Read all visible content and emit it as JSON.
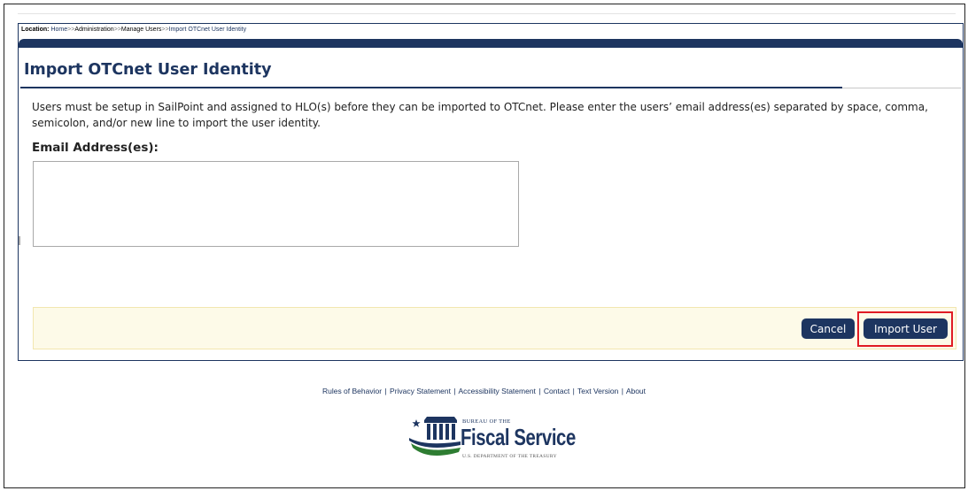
{
  "breadcrumb": {
    "label": "Location:",
    "items": [
      "Home",
      "Administration",
      "Manage Users",
      "Import OTCnet User Identity"
    ],
    "separator": ">>"
  },
  "page": {
    "title": "Import OTCnet User Identity",
    "instructions": "Users must be setup in SailPoint and assigned to HLO(s) before they can be imported to OTCnet. Please enter the users’ email address(es) separated by space, comma, semicolon, and/or new line to import the user identity."
  },
  "form": {
    "email_label": "Email Address(es):",
    "email_value": ""
  },
  "actions": {
    "cancel_label": "Cancel",
    "import_label": "Import User"
  },
  "footer": {
    "links": [
      "Rules of Behavior",
      "Privacy Statement",
      "Accessibility Statement",
      "Contact",
      "Text Version",
      "About"
    ],
    "separator": "|"
  },
  "logo": {
    "line1": "BUREAU OF THE",
    "line2": "Fiscal Service",
    "line3": "U.S. DEPARTMENT OF THE TREASURY"
  },
  "colors": {
    "brand_navy": "#1d3560",
    "action_bar_bg": "#fdfae8",
    "highlight_red": "#e01b24",
    "logo_green": "#2e7d32"
  }
}
